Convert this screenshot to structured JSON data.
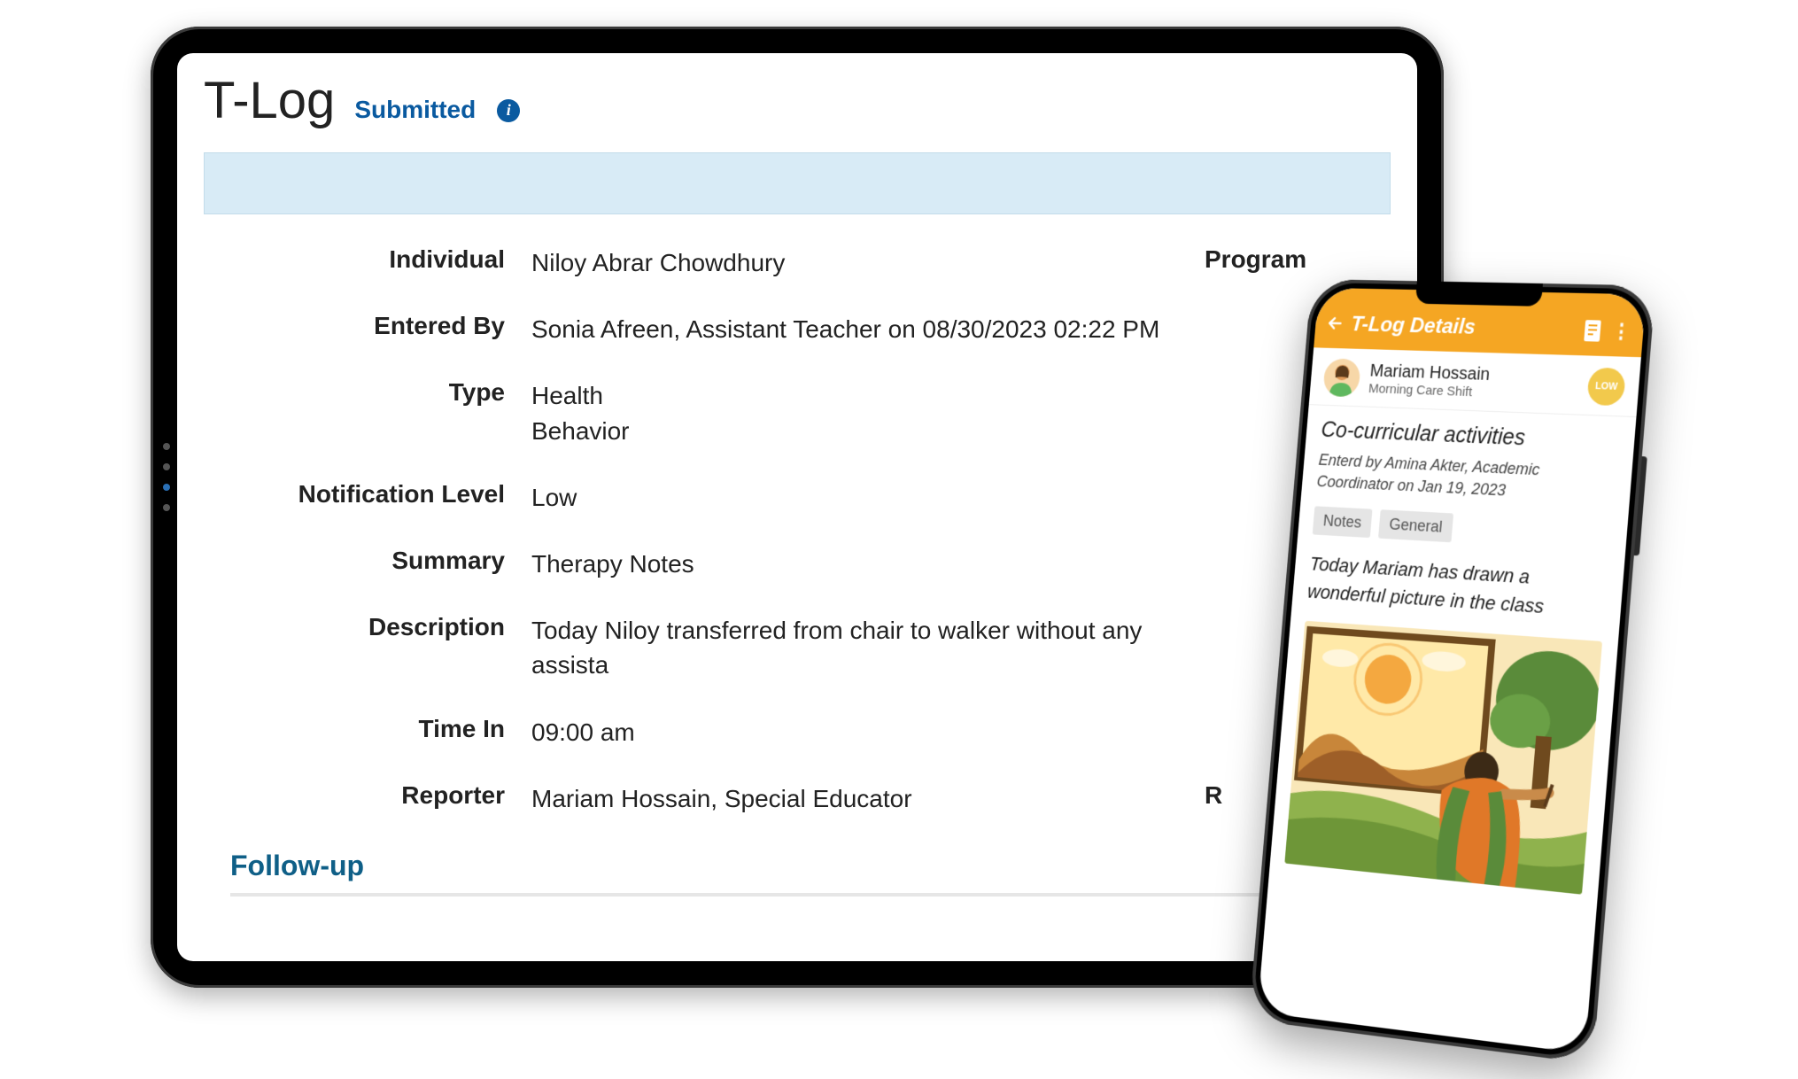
{
  "tablet": {
    "title": "T-Log",
    "status": "Submitted",
    "fields": {
      "individual_label": "Individual",
      "individual_value": "Niloy Abrar Chowdhury",
      "program_label": "Program",
      "entered_by_label": "Entered By",
      "entered_by_value": "Sonia Afreen, Assistant Teacher on 08/30/2023 02:22 PM",
      "type_label": "Type",
      "type_value_1": "Health",
      "type_value_2": "Behavior",
      "notification_level_label": "Notification Level",
      "notification_level_value": "Low",
      "summary_label": "Summary",
      "summary_value": "Therapy Notes",
      "description_label": "Description",
      "description_value": "Today Niloy transferred from chair to walker without any assista",
      "time_in_label": "Time In",
      "time_in_value": "09:00 am",
      "reporter_label": "Reporter",
      "reporter_value": "Mariam Hossain, Special Educator",
      "right_reporter_label": "R"
    },
    "followup_heading": "Follow-up"
  },
  "phone": {
    "header_title": "T-Log Details",
    "user_name": "Mariam Hossain",
    "user_subtitle": "Morning Care Shift",
    "badge_text": "LOW",
    "activity_title": "Co-curricular activities",
    "entered_by": "Enterd by Amina Akter, Academic Coordinator on Jan 19, 2023",
    "tags": {
      "notes": "Notes",
      "general": "General"
    },
    "description": "Today Mariam has drawn a wonderful picture in the class"
  }
}
